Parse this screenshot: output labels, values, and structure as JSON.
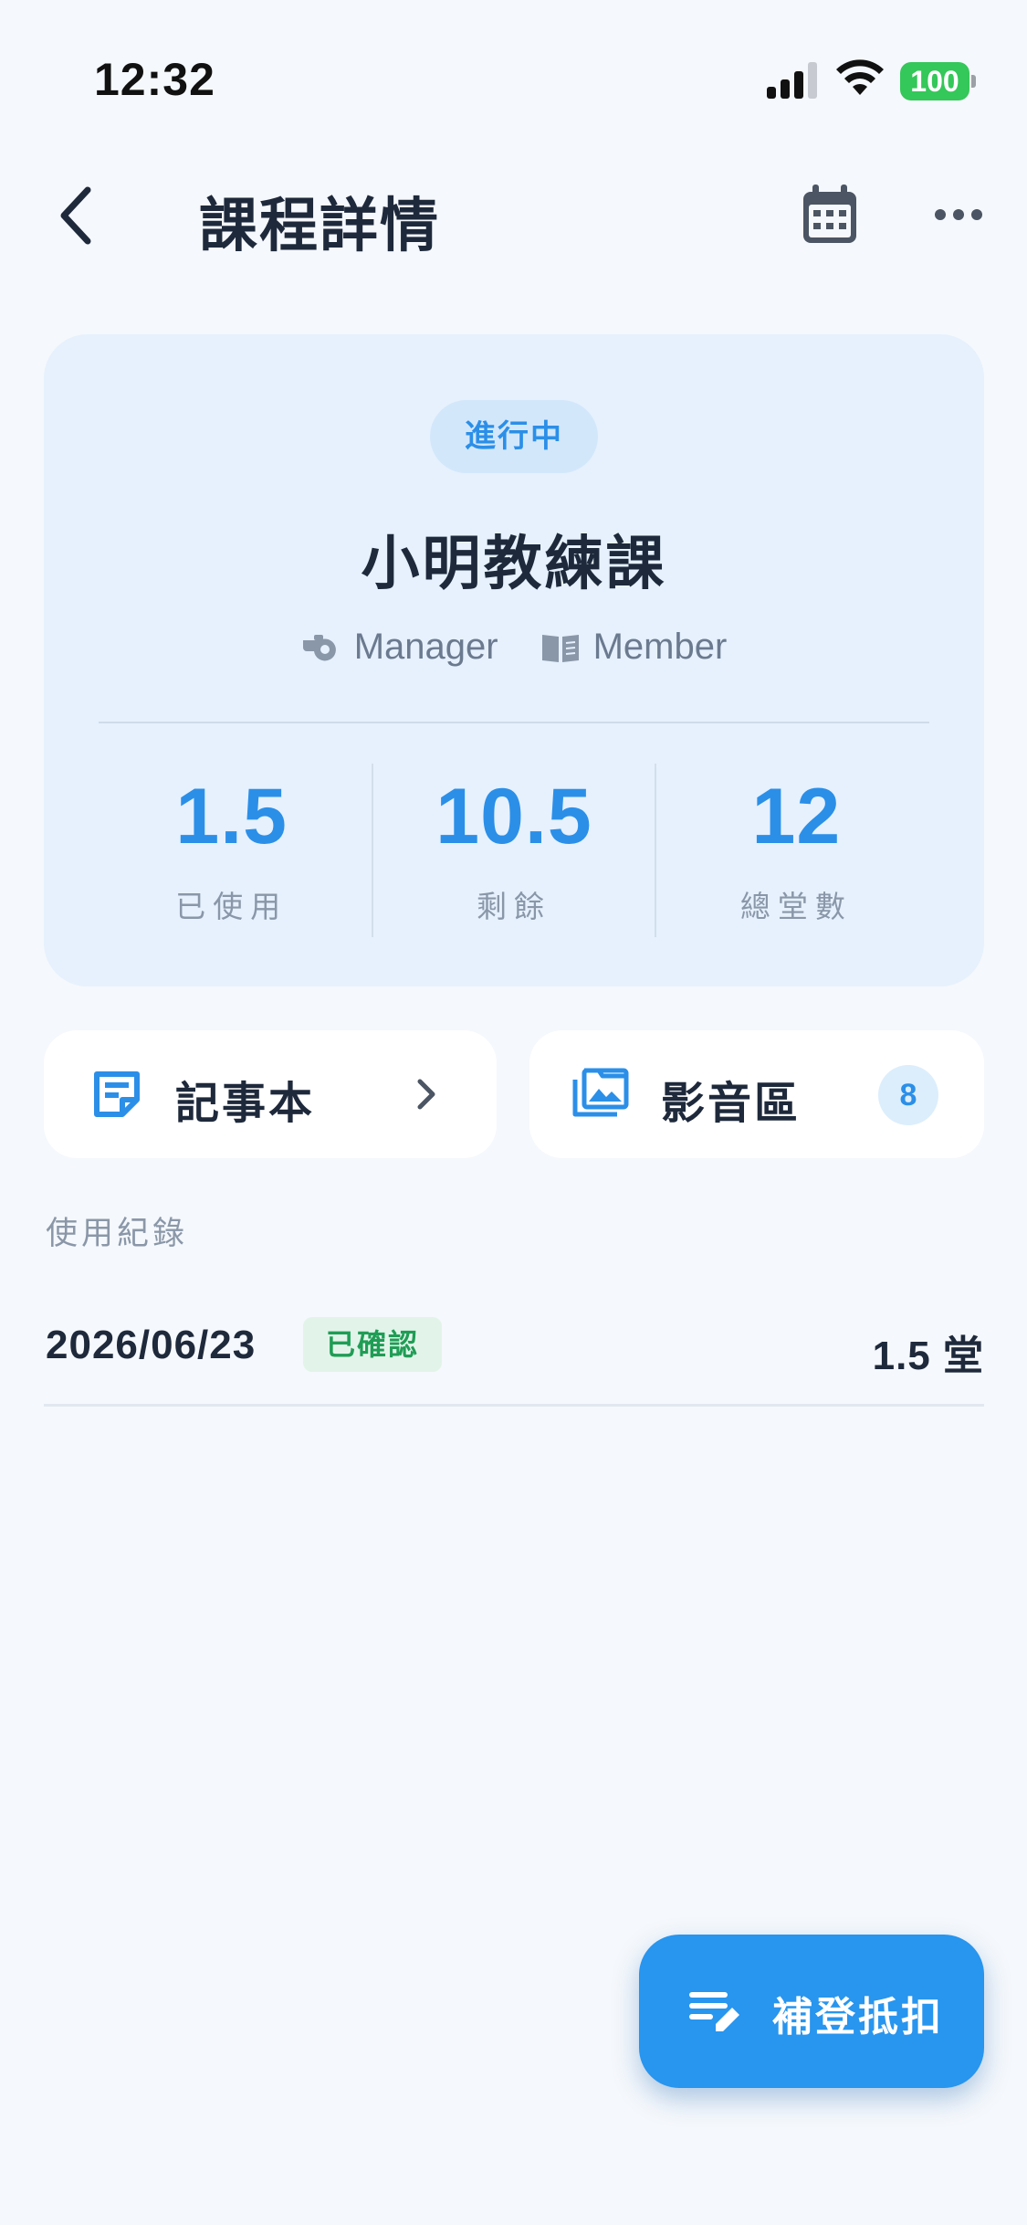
{
  "status_bar": {
    "time": "12:32",
    "battery": "100",
    "battery_color": "#34c759"
  },
  "header": {
    "title": "課程詳情",
    "back_icon": "chevron-left-icon",
    "calendar_icon": "calendar-icon",
    "more_icon": "more-horizontal-icon"
  },
  "course": {
    "status": "進行中",
    "title": "小明教練課",
    "roles": [
      {
        "icon": "whistle-icon",
        "label": "Manager"
      },
      {
        "icon": "book-icon",
        "label": "Member"
      }
    ],
    "stats": [
      {
        "value": "1.5",
        "label": "已使用"
      },
      {
        "value": "10.5",
        "label": "剩餘"
      },
      {
        "value": "12",
        "label": "總堂數"
      }
    ]
  },
  "actions": {
    "notebook": {
      "label": "記事本",
      "icon": "note-icon"
    },
    "media": {
      "label": "影音區",
      "icon": "photo-library-icon",
      "count": "8"
    }
  },
  "records": {
    "section_title": "使用紀錄",
    "items": [
      {
        "date": "2026/06/23",
        "status": "已確認",
        "amount": "1.5 堂"
      }
    ]
  },
  "fab": {
    "label": "補登抵扣",
    "icon": "edit-note-icon"
  },
  "colors": {
    "accent": "#2895ee",
    "background": "#f5f8fc",
    "card": "#e6f1fd",
    "confirmed": "#1f9d55"
  }
}
